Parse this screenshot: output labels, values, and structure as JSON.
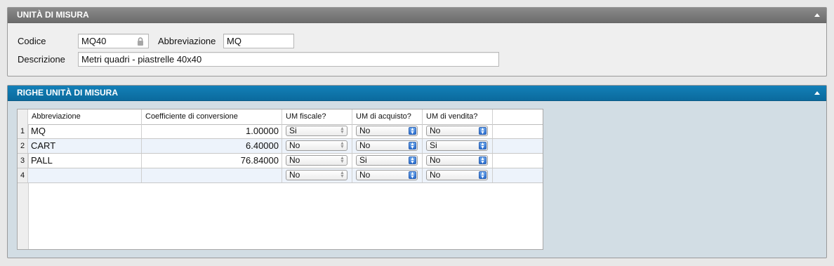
{
  "panel_unita": {
    "title": "UNITÀ DI MISURA",
    "codice_label": "Codice",
    "codice_value": "MQ40",
    "abbreviazione_label": "Abbreviazione",
    "abbreviazione_value": "MQ",
    "descrizione_label": "Descrizione",
    "descrizione_value": "Metri quadri - piastrelle 40x40"
  },
  "panel_righe": {
    "title": "RIGHE UNITÀ DI MISURA",
    "columns": {
      "abbreviazione": "Abbreviazione",
      "coefficiente": "Coefficiente di conversione",
      "um_fiscale": "UM fiscale?",
      "um_acquisto": "UM di acquisto?",
      "um_vendita": "UM di vendita?"
    },
    "rows": [
      {
        "num": "1",
        "abbreviazione": "MQ",
        "coefficiente": "1.00000",
        "um_fiscale": "Si",
        "um_acquisto": "No",
        "um_vendita": "No"
      },
      {
        "num": "2",
        "abbreviazione": "CART",
        "coefficiente": "6.40000",
        "um_fiscale": "No",
        "um_acquisto": "No",
        "um_vendita": "Si"
      },
      {
        "num": "3",
        "abbreviazione": "PALL",
        "coefficiente": "76.84000",
        "um_fiscale": "No",
        "um_acquisto": "Si",
        "um_vendita": "No"
      },
      {
        "num": "4",
        "abbreviazione": "",
        "coefficiente": "",
        "um_fiscale": "No",
        "um_acquisto": "No",
        "um_vendita": "No"
      }
    ]
  },
  "colors": {
    "header_grey": "#7a7a7a",
    "header_blue": "#0e74aa",
    "panel_blue_bg": "#d2dde4",
    "row_alt": "#edf3fb"
  },
  "icons": {
    "lock": "lock-icon",
    "collapse": "triangle-up-icon",
    "select_arrows": "updown-arrows-icon"
  }
}
